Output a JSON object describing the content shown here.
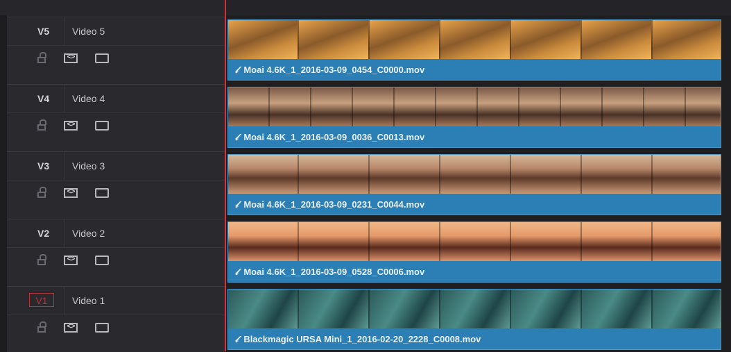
{
  "tracks": [
    {
      "id": "V5",
      "name": "Video 5",
      "clip": "Moai 4.6K_1_2016-03-09_0454_C0000.mov"
    },
    {
      "id": "V4",
      "name": "Video 4",
      "clip": "Moai 4.6K_1_2016-03-09_0036_C0013.mov"
    },
    {
      "id": "V3",
      "name": "Video 3",
      "clip": "Moai 4.6K_1_2016-03-09_0231_C0044.mov"
    },
    {
      "id": "V2",
      "name": "Video 2",
      "clip": "Moai 4.6K_1_2016-03-09_0528_C0006.mov"
    },
    {
      "id": "V1",
      "name": "Video 1",
      "clip": "Blackmagic URSA Mini_1_2016-02-20_2228_C0008.mov"
    }
  ],
  "icons": {
    "link": "link-icon",
    "lock": "lock-icon",
    "auto_select": "auto-select-icon",
    "disable": "disable-track-icon"
  },
  "auto_select_glyph": "<>",
  "colors": {
    "clip": "#2b7fb4",
    "playhead": "#d2303c",
    "selected_track": "#b8323a"
  }
}
